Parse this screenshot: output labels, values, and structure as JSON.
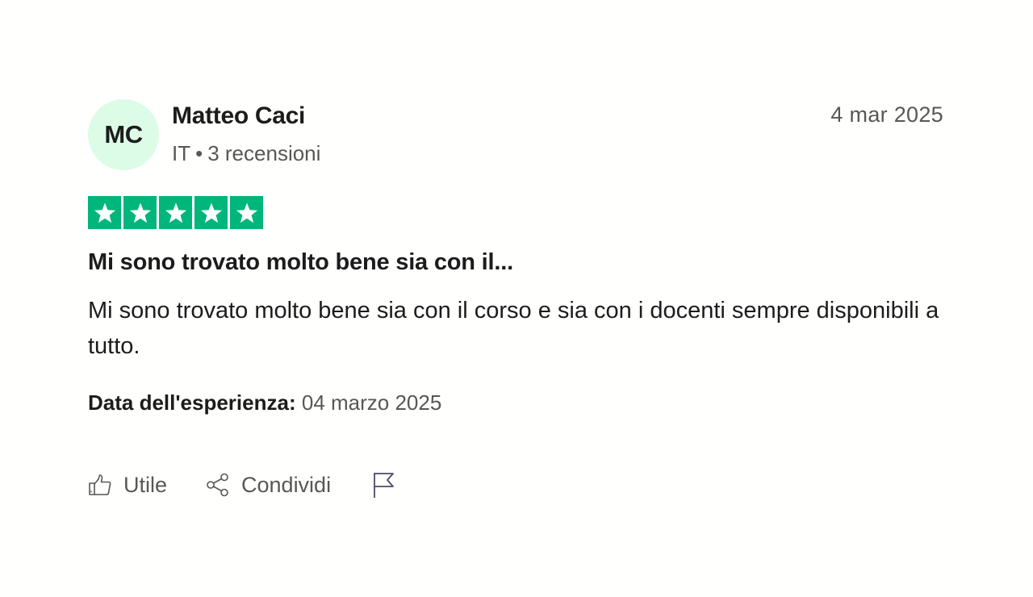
{
  "consumer": {
    "initials": "MC",
    "name": "Matteo Caci",
    "country": "IT",
    "separator": "•",
    "reviews_count": "3 recensioni",
    "avatar_color": "#dcfce7"
  },
  "review": {
    "date": "4 mar 2025",
    "rating": 5,
    "max_rating": 5,
    "star_color": "#00b67a",
    "title": "Mi sono trovato molto bene sia con il...",
    "text": "Mi sono trovato molto bene sia con il corso e sia con i docenti sempre disponibili a tutto.",
    "experience_label": "Data dell'esperienza:",
    "experience_date": "04 marzo 2025"
  },
  "actions": {
    "useful_label": "Utile",
    "share_label": "Condividi",
    "useful_icon": "thumbs-up-icon",
    "share_icon": "share-icon",
    "report_icon": "flag-icon"
  }
}
